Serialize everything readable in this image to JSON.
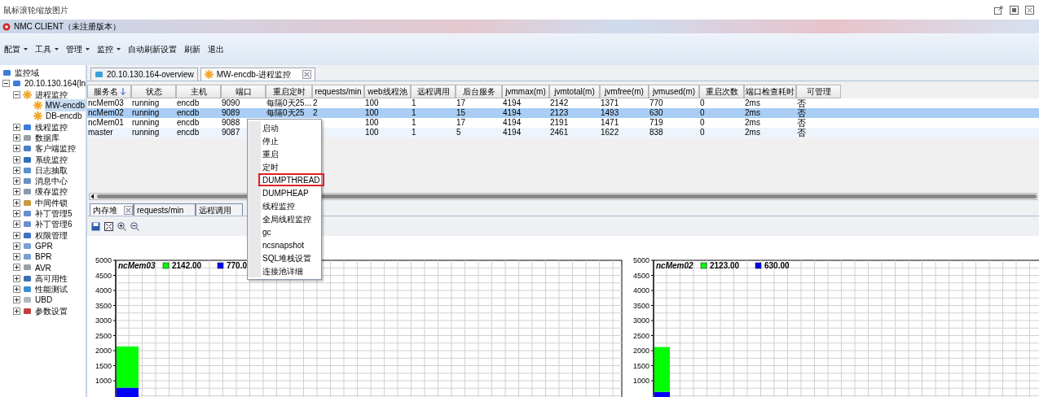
{
  "viewer": {
    "caption": "鼠标滚轮缩放图片"
  },
  "window": {
    "title": "NMC CLIENT（未注册版本）"
  },
  "menu": [
    {
      "label": "配置",
      "has_menu": true
    },
    {
      "label": "工具",
      "has_menu": true
    },
    {
      "label": "管理",
      "has_menu": true
    },
    {
      "label": "监控",
      "has_menu": true
    },
    {
      "label": "自动刷新设置",
      "has_menu": false
    },
    {
      "label": "刷新",
      "has_menu": false
    },
    {
      "label": "退出",
      "has_menu": false
    }
  ],
  "sidebar": {
    "items": [
      {
        "label": "监控域",
        "selected": false,
        "children": [
          {
            "label": "20.10.130.164(ln",
            "expanded": true,
            "selected": false,
            "children": [
              {
                "label": "进程监控",
                "expanded": true,
                "selected": false,
                "children": [
                  {
                    "label": "MW-encdb",
                    "selected": true
                  },
                  {
                    "label": "DB-encdb",
                    "selected": false
                  }
                ]
              },
              {
                "label": "线程监控",
                "expanded": false,
                "selected": false
              },
              {
                "label": "数据库",
                "expanded": false,
                "selected": false
              },
              {
                "label": "客户端监控",
                "expanded": false,
                "selected": false
              },
              {
                "label": "系统监控",
                "expanded": false,
                "selected": false
              },
              {
                "label": "日志抽取",
                "expanded": false,
                "selected": false
              },
              {
                "label": "消息中心",
                "expanded": false,
                "selected": false
              },
              {
                "label": "缓存监控",
                "expanded": false,
                "selected": false
              },
              {
                "label": "中间件锁",
                "expanded": false,
                "selected": false
              },
              {
                "label": "补丁管理5",
                "expanded": false,
                "selected": false
              },
              {
                "label": "补丁管理6",
                "expanded": false,
                "selected": false
              },
              {
                "label": "权限管理",
                "expanded": false,
                "selected": false
              },
              {
                "label": "GPR",
                "expanded": false,
                "selected": false
              },
              {
                "label": "BPR",
                "expanded": false,
                "selected": false
              },
              {
                "label": "AVR",
                "expanded": false,
                "selected": false
              },
              {
                "label": "高可用性",
                "expanded": false,
                "selected": false
              },
              {
                "label": "性能测试",
                "expanded": false,
                "selected": false
              },
              {
                "label": "UBD",
                "expanded": false,
                "selected": false
              },
              {
                "label": "参数设置",
                "expanded": false,
                "selected": false
              }
            ]
          }
        ]
      }
    ]
  },
  "tabs": [
    {
      "label": "20.10.130.164-overview",
      "selected": false,
      "closable": false
    },
    {
      "label": "MW-encdb-进程监控",
      "selected": true,
      "closable": true
    }
  ],
  "table": {
    "columns": [
      {
        "label": "服务名",
        "sorted": true
      },
      {
        "label": "状态",
        "sorted": false
      },
      {
        "label": "主机",
        "sorted": false
      },
      {
        "label": "端口",
        "sorted": false
      },
      {
        "label": "重启定时",
        "sorted": false
      },
      {
        "label": "requests/min",
        "sorted": false
      },
      {
        "label": "web线程池",
        "sorted": false
      },
      {
        "label": "远程调用",
        "sorted": false
      },
      {
        "label": "后台服务",
        "sorted": false
      },
      {
        "label": "jvmmax(m)",
        "sorted": false
      },
      {
        "label": "jvmtotal(m)",
        "sorted": false
      },
      {
        "label": "jvmfree(m)",
        "sorted": false
      },
      {
        "label": "jvmused(m)",
        "sorted": false
      },
      {
        "label": "重启次数",
        "sorted": false
      },
      {
        "label": "端口检查耗时",
        "sorted": false
      },
      {
        "label": "可管理",
        "sorted": false
      }
    ],
    "rows": [
      {
        "selected": false,
        "cells": [
          "ncMem03",
          "running",
          "encdb",
          "9090",
          "每隔0天25...",
          "2",
          "100",
          "1",
          "17",
          "4194",
          "2142",
          "1371",
          "770",
          "0",
          "2ms",
          "否"
        ]
      },
      {
        "selected": true,
        "cells": [
          "ncMem02",
          "running",
          "encdb",
          "9089",
          "每隔0天25",
          "2",
          "100",
          "1",
          "15",
          "4194",
          "2123",
          "1493",
          "630",
          "0",
          "2ms",
          "否"
        ]
      },
      {
        "selected": false,
        "cells": [
          "ncMem01",
          "running",
          "encdb",
          "9088",
          null,
          null,
          "100",
          "1",
          "17",
          "4194",
          "2191",
          "1471",
          "719",
          "0",
          "2ms",
          "否"
        ]
      },
      {
        "selected": false,
        "cells": [
          "master",
          "running",
          "encdb",
          "9087",
          null,
          null,
          "100",
          "1",
          "5",
          "4194",
          "2461",
          "1622",
          "838",
          "0",
          "2ms",
          "否"
        ]
      }
    ]
  },
  "context_menu": {
    "items": [
      {
        "label": "启动",
        "marked": false
      },
      {
        "label": "停止",
        "marked": false
      },
      {
        "label": "重启",
        "marked": false
      },
      {
        "label": "定时",
        "marked": false
      },
      {
        "label": "DUMPTHREAD",
        "marked": true
      },
      {
        "label": "DUMPHEAP",
        "marked": false
      },
      {
        "label": "线程监控",
        "marked": false
      },
      {
        "label": "全局线程监控",
        "marked": false
      },
      {
        "label": "gc",
        "marked": false
      },
      {
        "label": "ncsnapshot",
        "marked": false
      },
      {
        "label": "SQL堆栈设置",
        "marked": false
      },
      {
        "label": "连接池详细",
        "marked": false
      }
    ]
  },
  "lower_tabs": [
    {
      "label": "内存堆",
      "selected": true,
      "closable": true
    },
    {
      "label": "requests/min",
      "selected": false,
      "closable": false
    },
    {
      "label": "远程调用",
      "selected": false,
      "closable": false
    }
  ],
  "charts": [
    {
      "chart_data": {
        "type": "bar",
        "title": "ncMem03",
        "stacked": true,
        "grid": true,
        "legend": true,
        "ylim": [
          0,
          5000
        ],
        "yticks": [
          1000,
          1500,
          2000,
          2500,
          3000,
          3500,
          4000,
          4500,
          5000
        ],
        "series": [
          {
            "name": "2142.00",
            "color": "#00ff00",
            "values": [
              1370
            ]
          },
          {
            "name": "770.0",
            "color": "#0000ff",
            "values": [
              770
            ]
          }
        ]
      }
    },
    {
      "chart_data": {
        "type": "bar",
        "title": "ncMem02",
        "stacked": true,
        "grid": true,
        "legend": true,
        "ylim": [
          0,
          5000
        ],
        "yticks": [
          1000,
          1500,
          2000,
          2500,
          3000,
          3500,
          4000,
          4500,
          5000
        ],
        "series": [
          {
            "name": "2123.00",
            "color": "#00ff00",
            "values": [
              1490
            ]
          },
          {
            "name": "630.00",
            "color": "#0000ff",
            "values": [
              630
            ]
          }
        ]
      }
    }
  ]
}
